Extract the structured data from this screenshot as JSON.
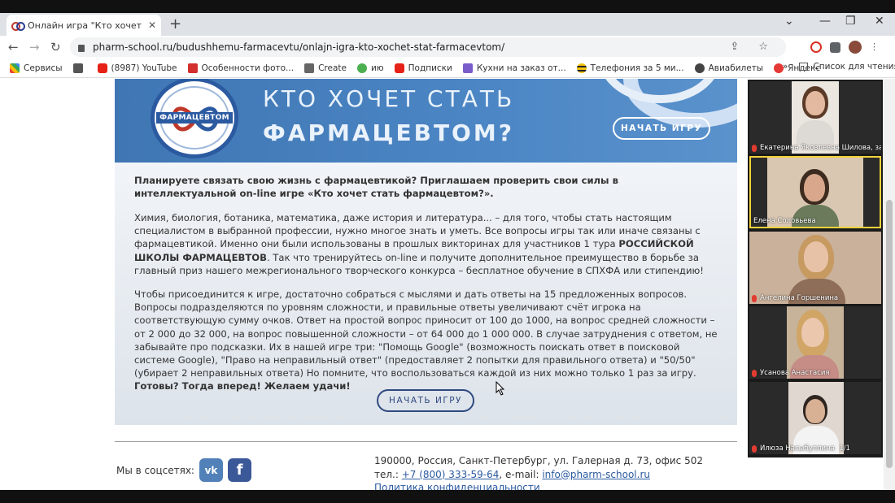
{
  "browser": {
    "tab_title": "Онлайн игра \"Кто хочет стать ф",
    "url": "pharm-school.ru/budushhemu-farmacevtu/onlajn-igra-kto-xochet-stat-farmacevtom/",
    "new_tab": "+",
    "tab_close": "✕",
    "window_controls": {
      "dropdown": "⌄",
      "minimize": "—",
      "restore": "❐",
      "close": "✕"
    },
    "nav": {
      "back": "←",
      "forward": "→",
      "reload": "↻"
    },
    "omni_actions": "⇪ ☆",
    "bookmarks": [
      {
        "label": "Сервисы",
        "color": "#e8a33a"
      },
      {
        "label": "",
        "color": "#555555"
      },
      {
        "label": "(8987) YouTube",
        "color": "#e62117"
      },
      {
        "label": "Особенности фото...",
        "color": "#d32f2f"
      },
      {
        "label": "Create",
        "color": "#666666"
      },
      {
        "label": "ию",
        "color": "#4caf50"
      },
      {
        "label": "Подписки",
        "color": "#e62117"
      },
      {
        "label": "Кухни на заказ от...",
        "color": "#7a5cc9"
      },
      {
        "label": "Телефония за 5 ми...",
        "color": "#f4c20d"
      },
      {
        "label": "Авиабилеты",
        "color": "#444444"
      },
      {
        "label": "Яндекс",
        "color": "#e53935"
      }
    ],
    "bookmarks_more": "»",
    "reading_list": "Список для чтения"
  },
  "hero": {
    "logo_text": "ФАРМАЦЕВТОМ",
    "title_line1": "КТО ХОЧЕТ СТАТЬ",
    "title_line2": "ФАРМАЦЕВТОМ?",
    "start_button": "НАЧАТЬ ИГРУ"
  },
  "content": {
    "intro": "Планируете связать свою жизнь с фармацевтикой? Приглашаем проверить свои силы в интеллектуальной on-line игре «Кто хочет стать фармацевтом?».",
    "para2_a": "Химия, биология, ботаника, математика, даже история и литература... – для того, чтобы стать настоящим специалистом в выбранной профессии, нужно многое знать и уметь. Все вопросы игры так или иначе связаны с фармацевтикой. Именно они были использованы в прошлых викторинах для участников 1 тура ",
    "para2_bold": "РОССИЙСКОЙ ШКОЛЫ ФАРМАЦЕВТОВ",
    "para2_b": ". Так что тренируйтесь on-line и получите дополнительное преимущество в борьбе за главный приз нашего межрегионального творческого конкурса – бесплатное обучение в СПХФА или стипендию!",
    "para3_a": "Чтобы присоединится к игре, достаточно собраться с мыслями и дать ответы на 15 предложенных вопросов. Вопросы подразделяются по уровням сложности, и правильные ответы увеличивают счёт игрока на соответствующую сумму очков. Ответ на простой вопрос приносит от 100 до 1000, на вопрос средней сложности – от 2 000 до 32 000, на вопрос повышенной сложности – от 64 000 до 1 000 000. В случае затруднения с ответом, не забывайте про подсказки. Их в нашей игре три: \"Помощь Google\" (возможность поискать ответ в поисковой системе Google), \"Право на неправильный ответ\" (предоставляет 2 попытки для правильного ответа) и \"50/50\" (убирает 2 неправильных ответа) Но помните, что воспользоваться каждой из них можно только 1 раз за игру. ",
    "para3_bold": "Готовы? Тогда вперед! Желаем удачи!",
    "start_button": "НАЧАТЬ ИГРУ"
  },
  "footer": {
    "social_label": "Мы в соцсетях:",
    "vk": "vk",
    "fb": "f",
    "address": "190000, Россия, Санкт-Петербург, ул. Галерная д. 73, офис 502",
    "phone_label": "тел.: ",
    "phone": "+7 (800) 333-59-64",
    "email_label": ", e-mail: ",
    "email": "info@pharm-school.ru",
    "privacy": "Политика конфиденциальности"
  },
  "participants": [
    {
      "name": "Екатерина Яковлевна Шилова, за...",
      "muted": true,
      "bg": "#e9e4de",
      "skin": "#e3b9a0",
      "hair": "#5b3a28"
    },
    {
      "name": "Елена Соловьева",
      "muted": false,
      "bg": "#d8c6b0",
      "skin": "#d9a88c",
      "hair": "#3d2b20"
    },
    {
      "name": "Ангелина Горшенина",
      "muted": true,
      "bg": "#c9b19b",
      "skin": "#e8c2a6",
      "hair": "#c79a62"
    },
    {
      "name": "Усанова Анастасия",
      "muted": true,
      "bg": "#c7b39a",
      "skin": "#eac7ad",
      "hair": "#d0a566"
    },
    {
      "name": "Илюза Насыбуллина",
      "muted": true,
      "bg": "#e0d8d0",
      "skin": "#d8b094",
      "hair": "#2e2420"
    }
  ],
  "participants_page": "1/1"
}
